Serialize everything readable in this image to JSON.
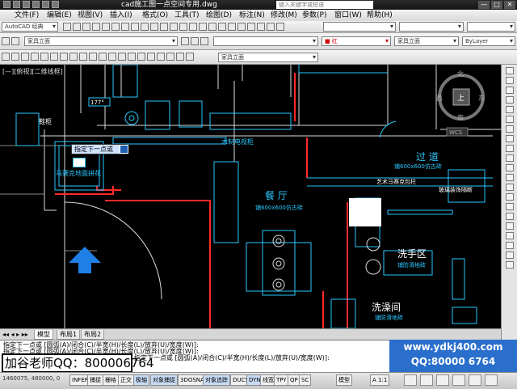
{
  "titlebar": {
    "title": "cad施工图一点空间专用.dwg",
    "search_placeholder": "键入关键字或短语",
    "minimize": "—",
    "maximize": "□",
    "close": "✕"
  },
  "menu": [
    "文件(F)",
    "编辑(E)",
    "视图(V)",
    "插入(I)",
    "格式(O)",
    "工具(T)",
    "绘图(D)",
    "标注(N)",
    "修改(M)",
    "参数(P)",
    "窗口(W)",
    "帮助(H)"
  ],
  "toolbar": {
    "workspace": "AutoCAD 经典",
    "layer_combo": "家具立面",
    "color_combo": "■ 红",
    "linetype_combo": "ByLayer",
    "lineweight_combo": "家具立面",
    "layer_combo2": "家具立面"
  },
  "viewport": {
    "label": "[—][俯视][二维线框]",
    "compass": {
      "north": "北",
      "south": "南",
      "east": "东",
      "west": "西",
      "center": "上",
      "wcs": "WCS"
    },
    "labels": {
      "cabinet": "鞋柜",
      "tv_cabinet": "木制电视柜",
      "corridor": "过 道",
      "corridor_floor": "铺600x600仿古砖",
      "mosaic": "艺术马赛克包柱",
      "glass": "玻璃装饰隔断",
      "dining": "餐 厅",
      "dining_floor": "铺600x600仿古砖",
      "mosaic_floor": "马赛克地面拼花",
      "washroom": "洗手区",
      "washroom_floor": "铺防滑地砖",
      "shower": "洗澡间",
      "shower_floor": "铺防滑地砖"
    },
    "tooltip": "指定下一点或",
    "dimension": "177°"
  },
  "layout_tabs": [
    "模型",
    "布局1",
    "布局2"
  ],
  "command_lines": [
    "指定下一点或 [圆弧(A)/闭合(C)/半宽(H)/长度(L)/放弃(U)/宽度(W)]:",
    "指定下一点或 [圆弧(A)/闭合(C)/半宽(H)/长度(L)/放弃(U)/宽度(W)]:",
    "指定下一点或 [圆弧(A)/闭合(C)/半宽(H)/长度(L)/放弃(U)/宽度(W)]:"
  ],
  "ad": {
    "teacher": "加谷老师QQ：800006764",
    "site": "www.ydkj400.com",
    "qq": "QQ:80000 6764"
  },
  "statusbar": {
    "coords": "1460075, 480000, 0",
    "buttons": [
      "INFER",
      "捕捉",
      "栅格",
      "正交",
      "极轴",
      "对象捕捉",
      "3DOSNAP",
      "对象追踪",
      "DUCS",
      "DYN",
      "线宽",
      "TPY",
      "QP",
      "SC"
    ],
    "model": "模型",
    "scale": "A 1:1"
  },
  "colors": {
    "cad_line": "#29c7ff",
    "wall_red": "#ff2a2a",
    "accent_blue": "#2a6fcc"
  }
}
